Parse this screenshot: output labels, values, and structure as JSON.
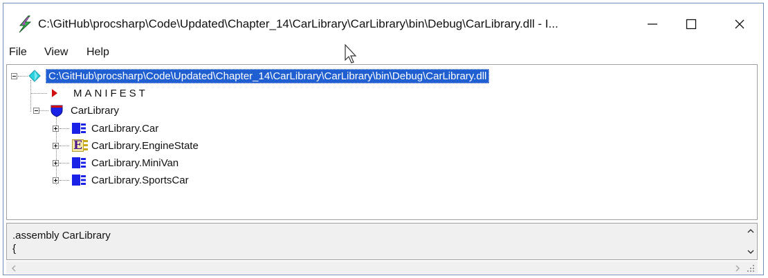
{
  "window": {
    "title": "C:\\GitHub\\procsharp\\Code\\Updated\\Chapter_14\\CarLibrary\\CarLibrary\\bin\\Debug\\CarLibrary.dll - I...",
    "controls": {
      "minimize": "—",
      "maximize": "☐",
      "close": "✕"
    }
  },
  "menu": [
    "File",
    "View",
    "Help"
  ],
  "tree": {
    "root": "C:\\GitHub\\procsharp\\Code\\Updated\\Chapter_14\\CarLibrary\\CarLibrary\\bin\\Debug\\CarLibrary.dll",
    "manifest": "MANIFEST",
    "namespace": "CarLibrary",
    "types": [
      {
        "label": "CarLibrary.Car",
        "icon": "class-icon"
      },
      {
        "label": "CarLibrary.EngineState",
        "icon": "enum-icon",
        "icon_letter": "E"
      },
      {
        "label": "CarLibrary.MiniVan",
        "icon": "class-icon"
      },
      {
        "label": "CarLibrary.SportsCar",
        "icon": "class-icon"
      }
    ]
  },
  "detail": {
    "line1": ".assembly CarLibrary",
    "line2": "{"
  },
  "colors": {
    "selection": "#1f5fd1",
    "class_icon": "#1a22e8",
    "manifest_icon": "#d01010",
    "root_icon": "#2ad3e0"
  }
}
